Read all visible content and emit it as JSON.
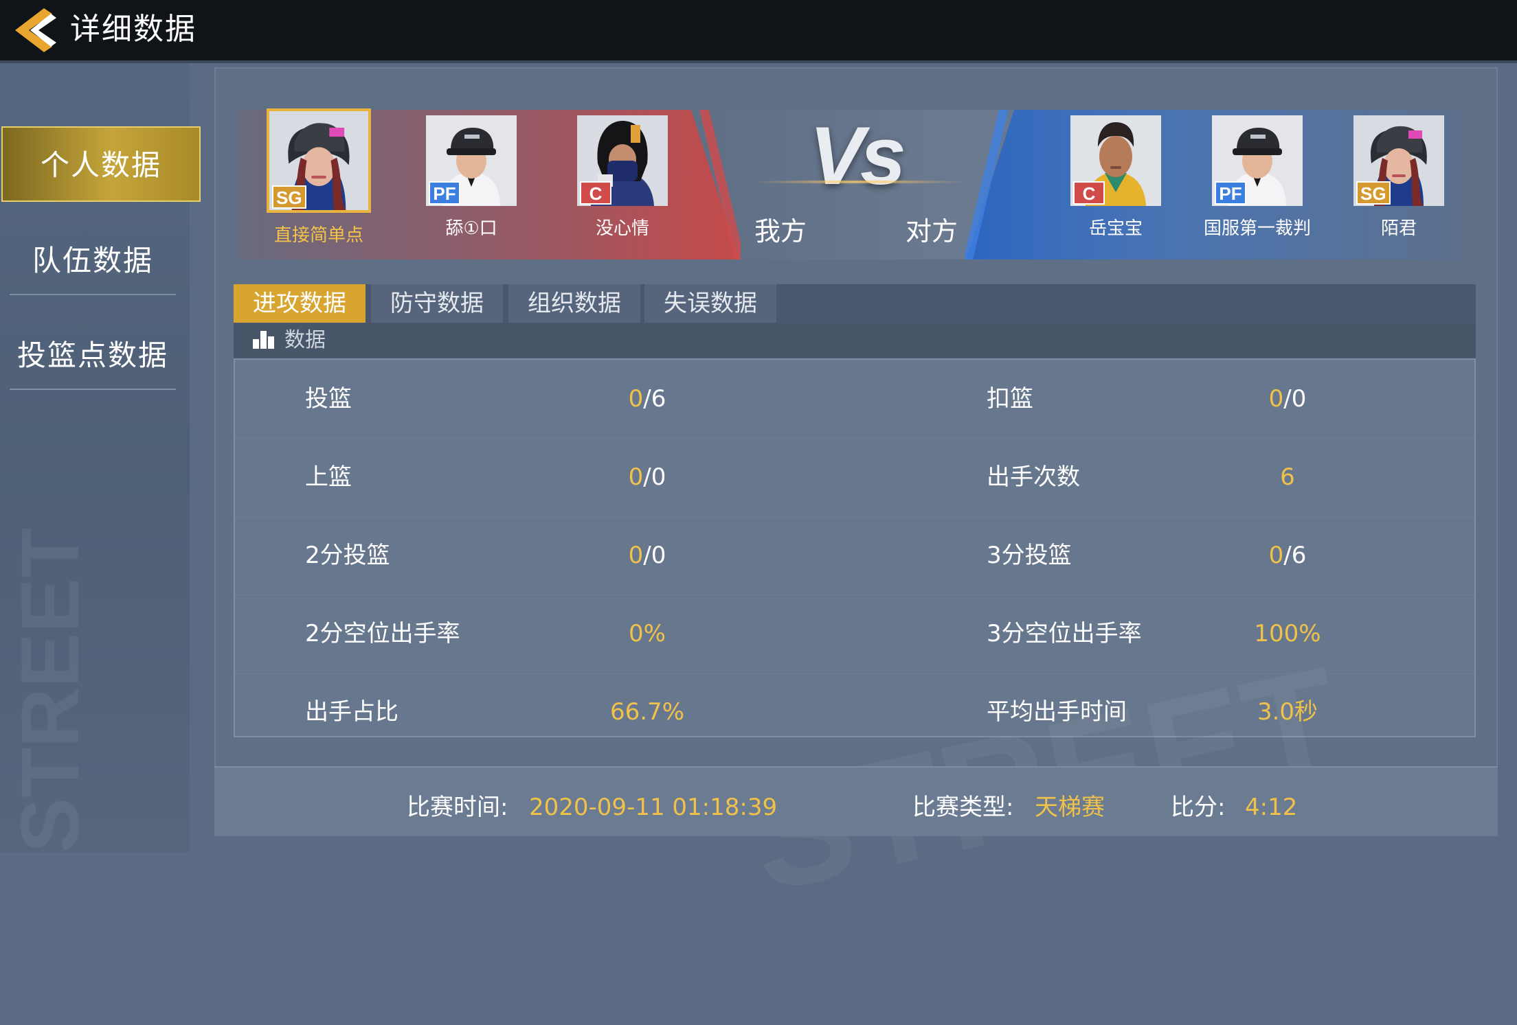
{
  "header": {
    "title": "详细数据"
  },
  "sidebar": {
    "items": [
      {
        "label": "个人数据",
        "active": true
      },
      {
        "label": "队伍数据",
        "active": false
      },
      {
        "label": "投篮点数据",
        "active": false
      }
    ]
  },
  "match": {
    "vs_text": "Vs",
    "my_side_label": "我方",
    "opp_side_label": "对方",
    "my_team": [
      {
        "name": "直接简单点",
        "position": "SG",
        "selected": true
      },
      {
        "name": "舔①口",
        "position": "PF",
        "selected": false
      },
      {
        "name": "没心情",
        "position": "C",
        "selected": false
      }
    ],
    "opp_team": [
      {
        "name": "岳宝宝",
        "position": "C"
      },
      {
        "name": "国服第一裁判",
        "position": "PF"
      },
      {
        "name": "陌君",
        "position": "SG"
      }
    ]
  },
  "tabs": [
    {
      "label": "进攻数据",
      "active": true
    },
    {
      "label": "防守数据",
      "active": false
    },
    {
      "label": "组织数据",
      "active": false
    },
    {
      "label": "失误数据",
      "active": false
    }
  ],
  "section": {
    "title": "数据",
    "icon": "bar-chart-icon"
  },
  "stats": [
    {
      "left_label": "投篮",
      "left_made": "0",
      "left_total": "/6",
      "right_label": "扣篮",
      "right_made": "0",
      "right_total": "/0"
    },
    {
      "left_label": "上篮",
      "left_made": "0",
      "left_total": "/0",
      "right_label": "出手次数",
      "right_made": "6",
      "right_total": ""
    },
    {
      "left_label": "2分投篮",
      "left_made": "0",
      "left_total": "/0",
      "right_label": "3分投篮",
      "right_made": "0",
      "right_total": "/6"
    },
    {
      "left_label": "2分空位出手率",
      "left_made": "0%",
      "left_total": "",
      "right_label": "3分空位出手率",
      "right_made": "100%",
      "right_total": ""
    },
    {
      "left_label": "出手占比",
      "left_made": "66.7%",
      "left_total": "",
      "right_label": "平均出手时间",
      "right_made": "3.0秒",
      "right_total": ""
    }
  ],
  "footer": {
    "time_label": "比赛时间:",
    "time_value": "2020-09-11 01:18:39",
    "type_label": "比赛类型:",
    "type_value": "天梯赛",
    "score_label": "比分:",
    "score_value": "4:12"
  },
  "colors": {
    "accent_gold": "#f1c24a",
    "red_team": "#c54a4a",
    "blue_team": "#2d66c0",
    "panel": "#5f6f86"
  }
}
